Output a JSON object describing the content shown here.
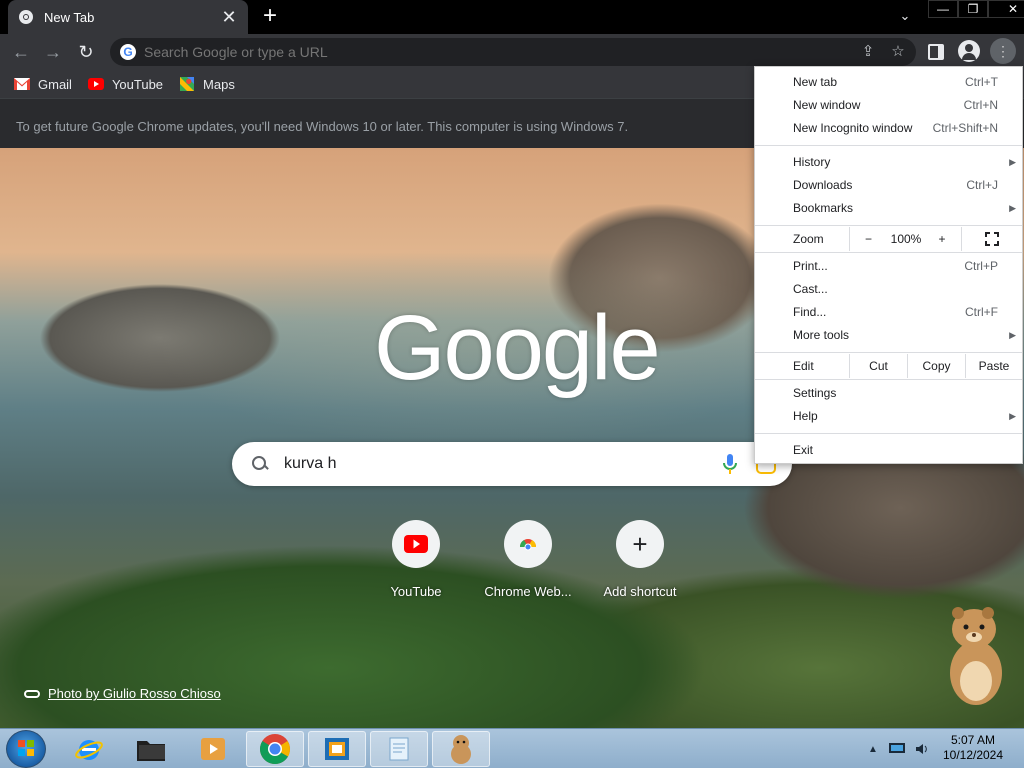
{
  "tab": {
    "title": "New Tab",
    "close": "✕"
  },
  "tab_strip": {
    "new_tab": "+",
    "search_tabs": "⌄",
    "minimize": "—",
    "maximize": "❐",
    "close": "✕"
  },
  "toolbar": {
    "back": "←",
    "forward": "→",
    "reload": "↻",
    "omnibox_placeholder": "Search Google or type a URL"
  },
  "bookmarks": [
    {
      "label": "Gmail",
      "icon": "gmail-icon"
    },
    {
      "label": "YouTube",
      "icon": "youtube-icon"
    },
    {
      "label": "Maps",
      "icon": "maps-icon"
    }
  ],
  "infobar": {
    "text": "To get future Google Chrome updates, you'll need Windows 10 or later. This computer is using Windows 7."
  },
  "ntp": {
    "logo": "Google",
    "search_value": "kurva h",
    "shortcuts": [
      {
        "label": "YouTube"
      },
      {
        "label": "Chrome Web..."
      },
      {
        "label": "Add shortcut"
      }
    ],
    "photo_credit": "Photo by Giulio Rosso Chioso"
  },
  "menu": {
    "new_tab": {
      "label": "New tab",
      "shortcut": "Ctrl+T"
    },
    "new_window": {
      "label": "New window",
      "shortcut": "Ctrl+N"
    },
    "new_incognito": {
      "label": "New Incognito window",
      "shortcut": "Ctrl+Shift+N"
    },
    "history": {
      "label": "History"
    },
    "downloads": {
      "label": "Downloads",
      "shortcut": "Ctrl+J"
    },
    "bookmarks": {
      "label": "Bookmarks"
    },
    "zoom": {
      "label": "Zoom",
      "minus": "−",
      "value": "100%",
      "plus": "+"
    },
    "print": {
      "label": "Print...",
      "shortcut": "Ctrl+P"
    },
    "cast": {
      "label": "Cast..."
    },
    "find": {
      "label": "Find...",
      "shortcut": "Ctrl+F"
    },
    "more_tools": {
      "label": "More tools"
    },
    "edit": {
      "label": "Edit",
      "cut": "Cut",
      "copy": "Copy",
      "paste": "Paste"
    },
    "settings": {
      "label": "Settings"
    },
    "help": {
      "label": "Help"
    },
    "exit": {
      "label": "Exit"
    }
  },
  "taskbar": {
    "time": "5:07 AM",
    "date": "10/12/2024"
  },
  "colors": {
    "tab_bg": "#35363a",
    "menu_bg": "#ffffff",
    "youtube_red": "#ff0000"
  }
}
